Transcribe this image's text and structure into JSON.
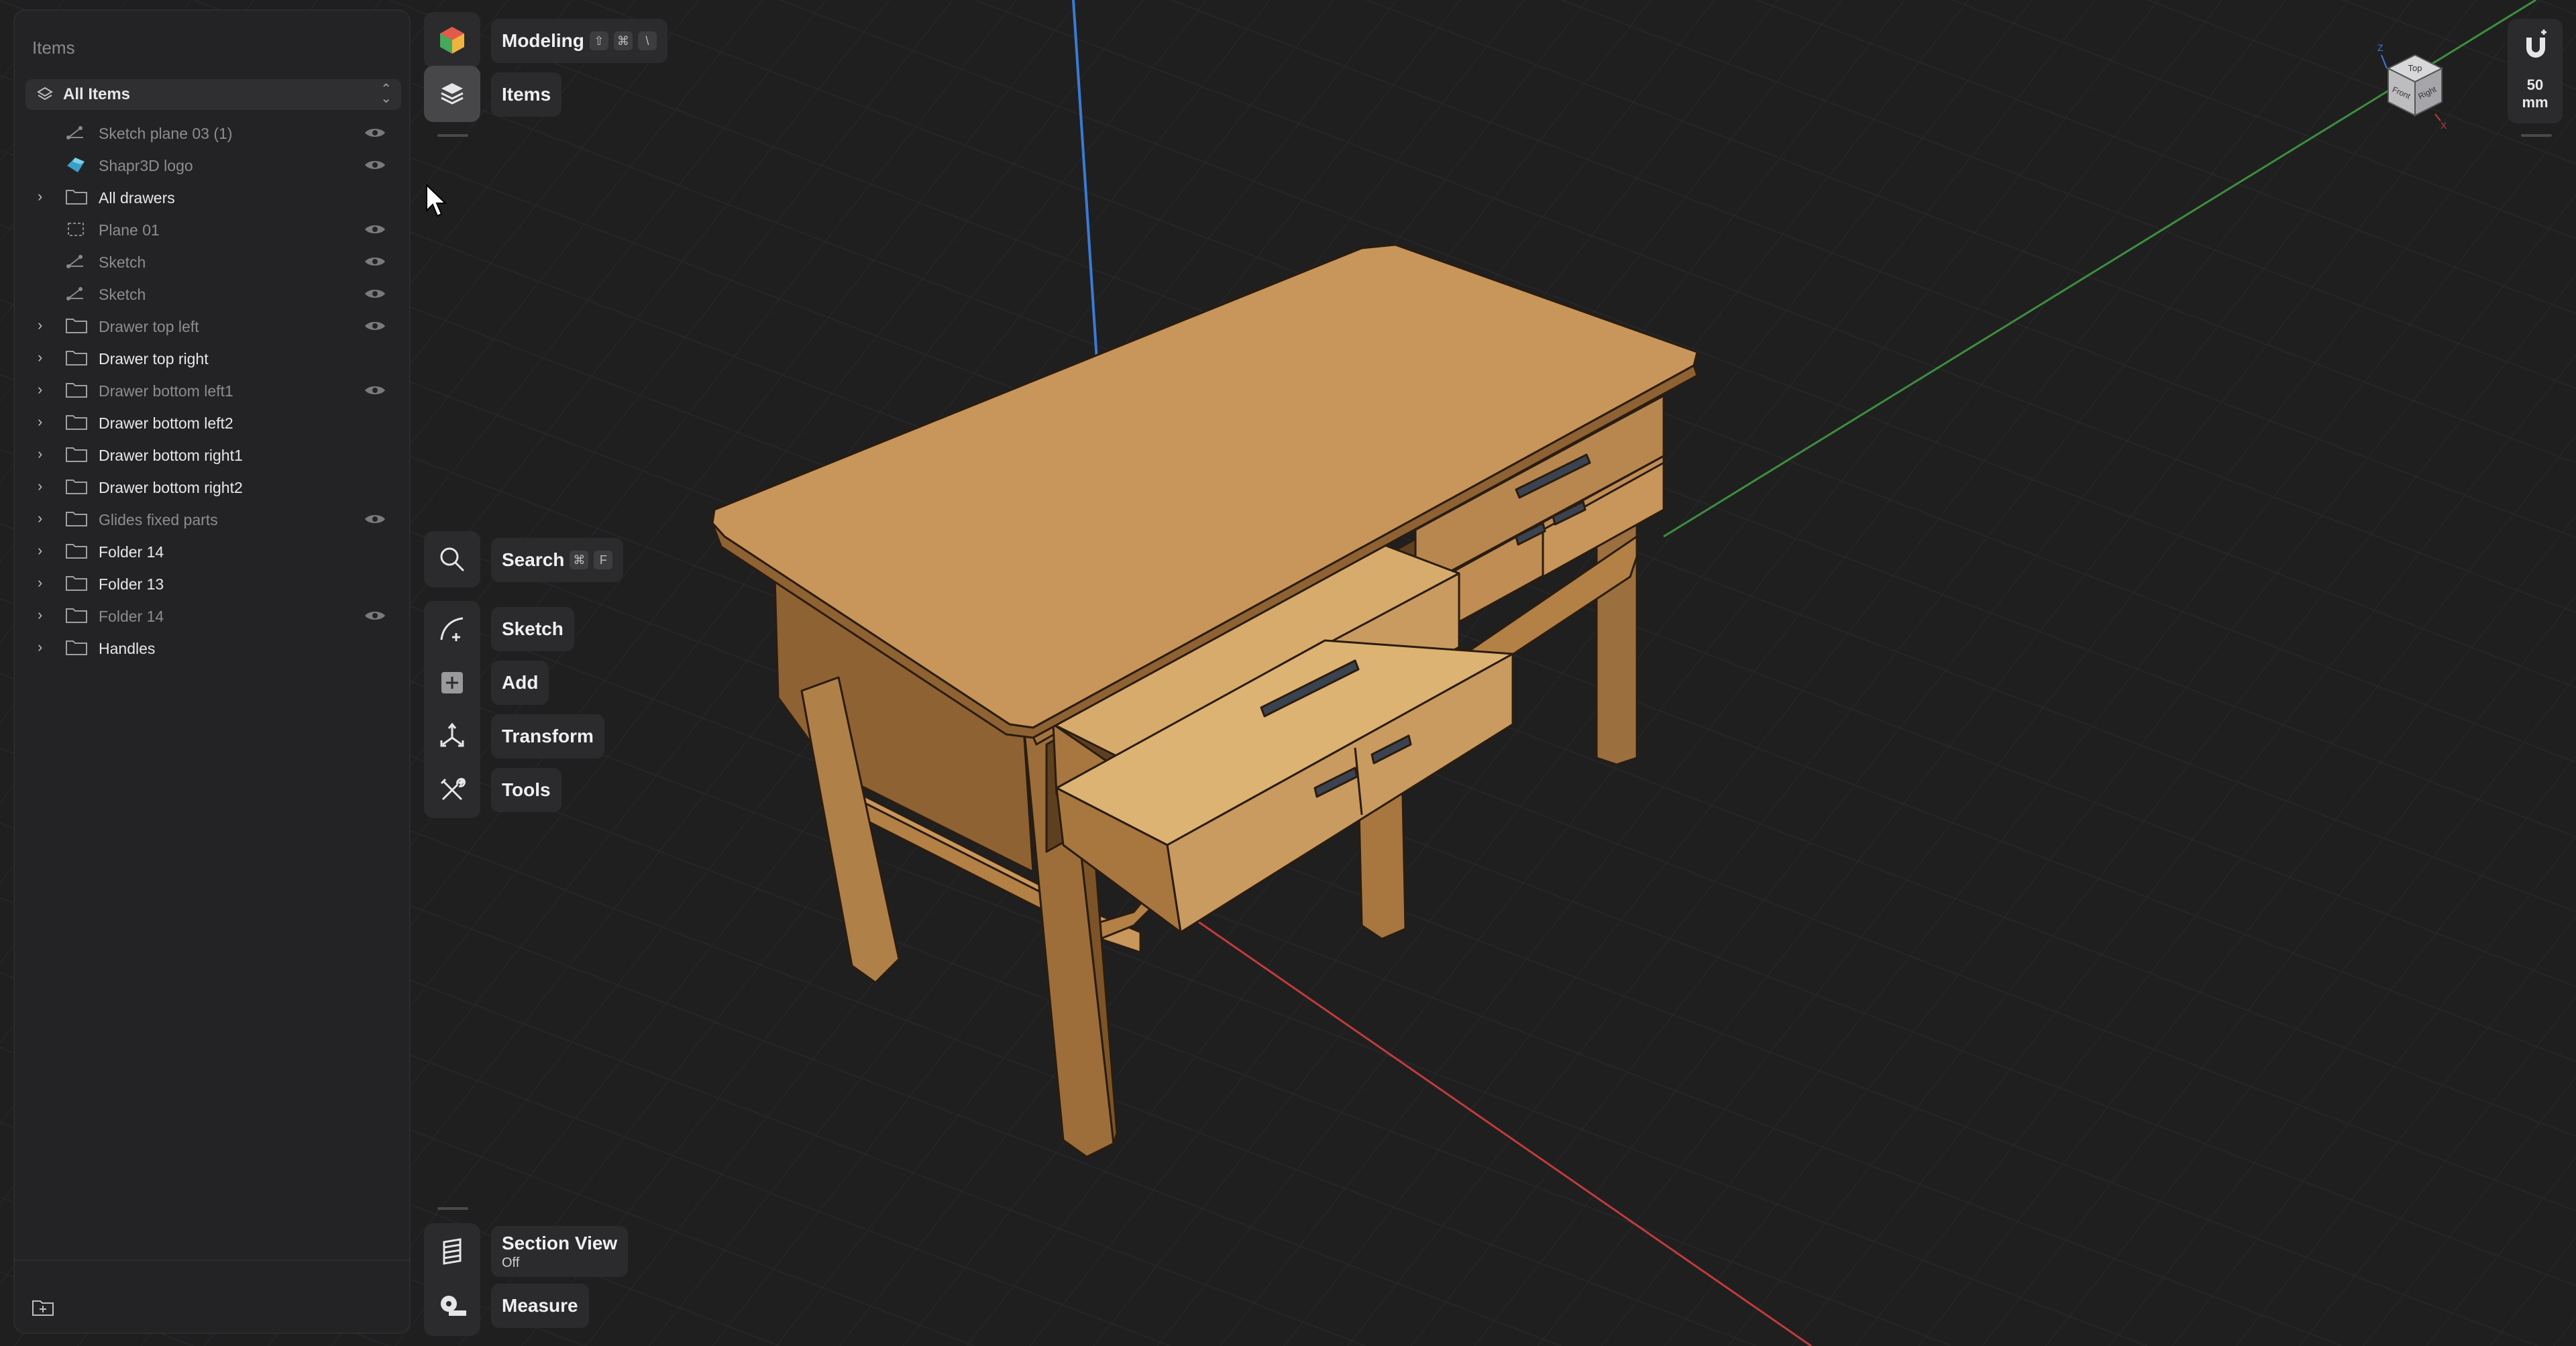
{
  "sidebar": {
    "title": "Items",
    "filter_label": "All Items",
    "items": [
      {
        "label": "Sketch plane 03 (1)",
        "icon": "sketch-icon",
        "expandable": false,
        "dim": true,
        "eye": true
      },
      {
        "label": "Shapr3D logo",
        "icon": "body-icon",
        "expandable": false,
        "dim": true,
        "eye": true
      },
      {
        "label": "All drawers",
        "icon": "folder-icon",
        "expandable": true,
        "dim": false,
        "eye": false
      },
      {
        "label": "Plane 01",
        "icon": "plane-icon",
        "expandable": false,
        "dim": true,
        "eye": true
      },
      {
        "label": "Sketch",
        "icon": "sketch-icon",
        "expandable": false,
        "dim": true,
        "eye": true
      },
      {
        "label": "Sketch",
        "icon": "sketch-icon",
        "expandable": false,
        "dim": true,
        "eye": true
      },
      {
        "label": "Drawer top left",
        "icon": "folder-icon",
        "expandable": true,
        "dim": true,
        "eye": true
      },
      {
        "label": "Drawer top right",
        "icon": "folder-icon",
        "expandable": true,
        "dim": false,
        "eye": false
      },
      {
        "label": "Drawer bottom left1",
        "icon": "folder-icon",
        "expandable": true,
        "dim": true,
        "eye": true
      },
      {
        "label": "Drawer bottom left2",
        "icon": "folder-icon",
        "expandable": true,
        "dim": false,
        "eye": false
      },
      {
        "label": "Drawer bottom right1",
        "icon": "folder-icon",
        "expandable": true,
        "dim": false,
        "eye": false
      },
      {
        "label": "Drawer bottom right2",
        "icon": "folder-icon",
        "expandable": true,
        "dim": false,
        "eye": false
      },
      {
        "label": "Glides fixed parts",
        "icon": "folder-icon",
        "expandable": true,
        "dim": true,
        "eye": true
      },
      {
        "label": "Folder 14",
        "icon": "folder-icon",
        "expandable": true,
        "dim": false,
        "eye": false
      },
      {
        "label": "Folder 13",
        "icon": "folder-icon",
        "expandable": true,
        "dim": false,
        "eye": false
      },
      {
        "label": "Folder 14",
        "icon": "folder-icon",
        "expandable": true,
        "dim": true,
        "eye": true
      },
      {
        "label": "Handles",
        "icon": "folder-icon",
        "expandable": true,
        "dim": false,
        "eye": false
      }
    ]
  },
  "toolbar": {
    "modeling_label": "Modeling",
    "modeling_keys": [
      "⇧",
      "⌘",
      "\\"
    ],
    "items_label": "Items",
    "search_label": "Search",
    "search_keys": [
      "⌘",
      "F"
    ],
    "sketch_label": "Sketch",
    "add_label": "Add",
    "transform_label": "Transform",
    "tools_label": "Tools",
    "section_view_label": "Section View",
    "section_view_state": "Off",
    "measure_label": "Measure"
  },
  "snap": {
    "value": "50",
    "unit": "mm"
  },
  "view_cube": {
    "top": "Top",
    "front": "Front",
    "right": "Right",
    "z": "Z",
    "x": "X"
  },
  "colors": {
    "accent_wood": "#b8874f",
    "axis_x": "#c23b3b",
    "axis_y": "#3e8e3e",
    "axis_z": "#3a7bd5"
  }
}
